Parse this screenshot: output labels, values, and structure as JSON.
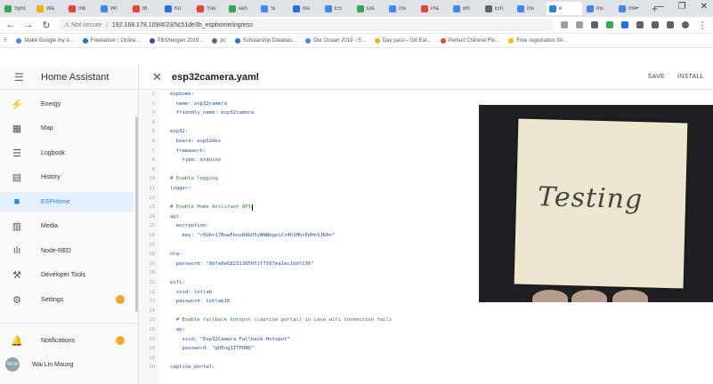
{
  "browser": {
    "tabs": [
      {
        "label": "Sync",
        "color": "#34a853"
      },
      {
        "label": "Wa",
        "color": "#f4b400"
      },
      {
        "label": "Inb",
        "color": "#ea4335"
      },
      {
        "label": "Wr",
        "color": "#4285f4"
      },
      {
        "label": "Bl",
        "color": "#ea4335"
      },
      {
        "label": "Ko",
        "color": "#1a73e8"
      },
      {
        "label": "You",
        "color": "#ea4335"
      },
      {
        "label": "sen",
        "color": "#34a853"
      },
      {
        "label": "Si",
        "color": "#4285f4"
      },
      {
        "label": "Ins",
        "color": "#1a73e8"
      },
      {
        "label": "ES",
        "color": "#4285f4"
      },
      {
        "label": "Dis",
        "color": "#34a853"
      },
      {
        "label": "Ins",
        "color": "#4285f4"
      },
      {
        "label": "Pla",
        "color": "#ea4335"
      },
      {
        "label": "wh",
        "color": "#4285f4"
      },
      {
        "label": "Em",
        "color": "#5f6368"
      },
      {
        "label": "Ins",
        "color": "#4285f4"
      },
      {
        "label": "e",
        "color": "#1e88e5"
      },
      {
        "label": "Ins",
        "color": "#4285f4"
      },
      {
        "label": "Ins",
        "color": "#4285f4"
      }
    ],
    "new_tab": "+",
    "window_controls": [
      "⌄",
      "—",
      "❐",
      "✕"
    ],
    "url_security": "⚠ Not secure",
    "url": "192.168.178.109/#/23/5c51de3b_esphome/ingress",
    "bookmarks": [
      {
        "label": "Make Google my d...",
        "color": "#4285f4"
      },
      {
        "label": "Freelancer | Online...",
        "color": "#1a73e8"
      },
      {
        "label": "TBS/tengen 2019...",
        "color": "#3949ab"
      },
      {
        "label": "pc",
        "color": "#5f6368"
      },
      {
        "label": "Scholarship Databas...",
        "color": "#1a73e8"
      },
      {
        "label": "Our Ocean 2019 - S...",
        "color": "#4285f4"
      },
      {
        "label": "Day pass - Gill Ear...",
        "color": "#f4b400"
      },
      {
        "label": "Perfect Chinese Flo...",
        "color": "#ea4335"
      },
      {
        "label": "Free registration for...",
        "color": "#fbbc04"
      }
    ]
  },
  "sidebar": {
    "title": "Home Assistant",
    "items": [
      {
        "label": "Energy",
        "icon": "⚡"
      },
      {
        "label": "Map",
        "icon": "▦"
      },
      {
        "label": "Logbook",
        "icon": "☰"
      },
      {
        "label": "History",
        "icon": "▤"
      },
      {
        "label": "ESPHome",
        "icon": "■"
      },
      {
        "label": "Media",
        "icon": "▥"
      },
      {
        "label": "Node-RED",
        "icon": "ılı"
      },
      {
        "label": "Developer Tools",
        "icon": "⚒"
      },
      {
        "label": "Settings",
        "icon": "⚙"
      }
    ],
    "notifications_label": "Notifications",
    "notifications_icon": "🔔",
    "user_name": "Wai Lin Maung",
    "user_initials": "WLM"
  },
  "editor": {
    "filename": "esp32camera.yaml",
    "save_label": "SAVE",
    "install_label": "INSTALL",
    "lines": [
      {
        "n": "1",
        "text": "esphome:",
        "type": "code"
      },
      {
        "n": "2",
        "text": "  name: esp32camera",
        "type": "code"
      },
      {
        "n": "3",
        "text": "  friendly_name: esp32camera",
        "type": "code"
      },
      {
        "n": "4",
        "text": "",
        "type": "code"
      },
      {
        "n": "5",
        "text": "esp32:",
        "type": "code"
      },
      {
        "n": "6",
        "text": "  board: esp32dev",
        "type": "code"
      },
      {
        "n": "7",
        "text": "  framework:",
        "type": "code"
      },
      {
        "n": "8",
        "text": "    type: arduino",
        "type": "code"
      },
      {
        "n": "9",
        "text": "",
        "type": "code"
      },
      {
        "n": "10",
        "text": "# Enable logging",
        "type": "comment"
      },
      {
        "n": "11",
        "text": "logger:",
        "type": "code"
      },
      {
        "n": "12",
        "text": "",
        "type": "code"
      },
      {
        "n": "13",
        "text": "# Enable Home Assistant API",
        "type": "comment"
      },
      {
        "n": "14",
        "text": "api:",
        "type": "code"
      },
      {
        "n": "15",
        "text": "  encryption:",
        "type": "code"
      },
      {
        "n": "16",
        "text": "    key: \"rOUb+17BowFbou08bU5yNNNbgeiCr4h1MhrPdHn3JKA=\"",
        "type": "code"
      },
      {
        "n": "17",
        "text": "",
        "type": "code"
      },
      {
        "n": "18",
        "text": "ota:",
        "type": "code"
      },
      {
        "n": "19",
        "text": "  password: \"8bfa8e682313050f2f7167ea1ec1bdf136\"",
        "type": "code"
      },
      {
        "n": "20",
        "text": "",
        "type": "code"
      },
      {
        "n": "21",
        "text": "wifi:",
        "type": "code"
      },
      {
        "n": "22",
        "text": "  ssid: lotlab",
        "type": "code"
      },
      {
        "n": "23",
        "text": "  password: lotlab16",
        "type": "code"
      },
      {
        "n": "24",
        "text": "",
        "type": "code"
      },
      {
        "n": "25",
        "text": "  # Enable fallback hotspot (captive portal) in case wifi connection fails",
        "type": "comment"
      },
      {
        "n": "26",
        "text": "  ap:",
        "type": "code"
      },
      {
        "n": "27",
        "text": "    ssid: \"Esp32Camera Fallback Hotspot\"",
        "type": "code"
      },
      {
        "n": "28",
        "text": "    password: \"gUEng1ITPUNQ\"",
        "type": "code"
      },
      {
        "n": "29",
        "text": "",
        "type": "code"
      },
      {
        "n": "30",
        "text": "captive_portal:",
        "type": "code"
      }
    ]
  },
  "camera": {
    "note_text": "Testing"
  }
}
